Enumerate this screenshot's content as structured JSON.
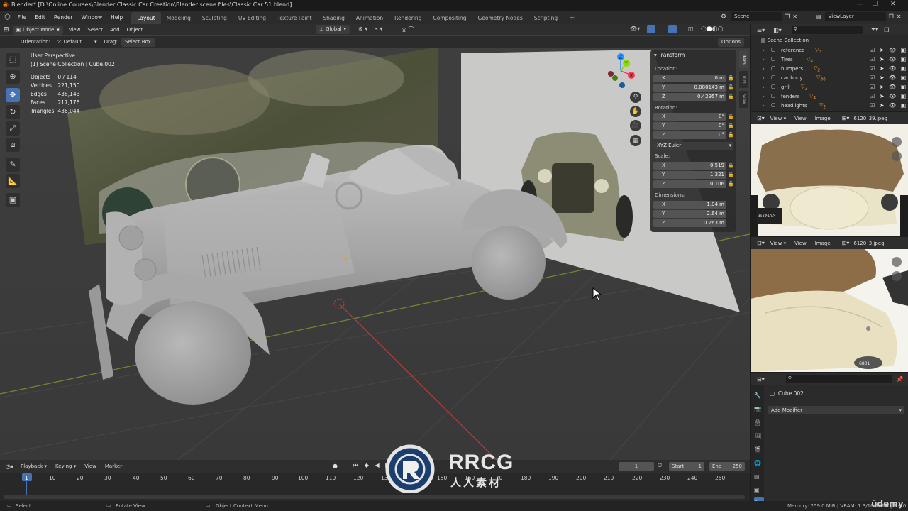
{
  "titlebar": {
    "title": "Blender* [D:\\Online Courses\\Blender Classic Car Creation\\Blender scene files\\Classic Car 51.blend]"
  },
  "menus": [
    "File",
    "Edit",
    "Render",
    "Window",
    "Help"
  ],
  "workspaces": [
    "Layout",
    "Modeling",
    "Sculpting",
    "UV Editing",
    "Texture Paint",
    "Shading",
    "Animation",
    "Rendering",
    "Compositing",
    "Geometry Nodes",
    "Scripting"
  ],
  "active_workspace": "Layout",
  "scene": {
    "scene_name": "Scene",
    "view_layer": "ViewLayer"
  },
  "viewport_header": {
    "mode": "Object Mode",
    "view": "View",
    "select": "Select",
    "add": "Add",
    "object": "Object",
    "transform_space": "Global"
  },
  "tool_header": {
    "orientation_label": "Orientation:",
    "orientation_value": "Default",
    "drag_label": "Drag:",
    "drag_value": "Select Box",
    "options": "Options"
  },
  "viewport_info": {
    "perspective": "User Perspective",
    "collection": "(1) Scene Collection | Cube.002"
  },
  "stats": [
    {
      "label": "Objects",
      "value": "0 / 114"
    },
    {
      "label": "Vertices",
      "value": "221,150"
    },
    {
      "label": "Edges",
      "value": "438,143"
    },
    {
      "label": "Faces",
      "value": "217,176"
    },
    {
      "label": "Triangles",
      "value": "436,044"
    }
  ],
  "npanel": {
    "title": "Transform",
    "location_label": "Location:",
    "location": [
      {
        "axis": "X",
        "value": "0 m"
      },
      {
        "axis": "Y",
        "value": "0.080143 m"
      },
      {
        "axis": "Z",
        "value": "0.42957 m"
      }
    ],
    "rotation_label": "Rotation:",
    "rotation": [
      {
        "axis": "X",
        "value": "0°"
      },
      {
        "axis": "Y",
        "value": "0°"
      },
      {
        "axis": "Z",
        "value": "0°"
      }
    ],
    "rotation_mode": "XYZ Euler",
    "scale_label": "Scale:",
    "scale": [
      {
        "axis": "X",
        "value": "0.519"
      },
      {
        "axis": "Y",
        "value": "1.321"
      },
      {
        "axis": "Z",
        "value": "0.106"
      }
    ],
    "dimensions_label": "Dimensions:",
    "dimensions": [
      {
        "axis": "X",
        "value": "1.04 m"
      },
      {
        "axis": "Y",
        "value": "2.64 m"
      },
      {
        "axis": "Z",
        "value": "0.263 m"
      }
    ],
    "tabs": [
      "Item",
      "Tool",
      "View"
    ]
  },
  "outliner": {
    "root": "Scene Collection",
    "items": [
      {
        "name": "reference",
        "badge": "3"
      },
      {
        "name": "Tires",
        "badge": "4"
      },
      {
        "name": "bumpers",
        "badge": "2"
      },
      {
        "name": "car body",
        "badge": "36"
      },
      {
        "name": "grill",
        "badge": "2"
      },
      {
        "name": "fenders",
        "badge": "4"
      },
      {
        "name": "headlights",
        "badge": "2"
      }
    ]
  },
  "image_editor_1": {
    "view": "View",
    "view2": "View",
    "image": "Image",
    "file": "6120_39.jpeg",
    "sign_text": "HYMAN"
  },
  "image_editor_2": {
    "view": "View",
    "view2": "View",
    "image": "Image",
    "file": "6120_3.jpeg",
    "badge_text": "6831"
  },
  "properties": {
    "object_name": "Cube.002",
    "add_modifier": "Add Modifier"
  },
  "timeline": {
    "menus": [
      "Playback",
      "Keying",
      "View",
      "Marker"
    ],
    "current_frame": "1",
    "start_label": "Start",
    "start": "1",
    "end_label": "End",
    "end": "250",
    "ticks": [
      "1",
      "10",
      "20",
      "30",
      "40",
      "50",
      "60",
      "70",
      "80",
      "90",
      "100",
      "110",
      "120",
      "130",
      "140",
      "150",
      "160",
      "170",
      "180",
      "190",
      "200",
      "210",
      "220",
      "230",
      "240",
      "250"
    ]
  },
  "statusbar": {
    "select": "Select",
    "rotate": "Rotate View",
    "context": "Object Context Menu",
    "memory": "Memory: 259.0 MiB | VRAM: 1.3/10.0 GiB | 3.0.0",
    "brand": "ūdemy"
  },
  "watermark": {
    "logo_text": "RRCG",
    "sub_text": "人人素材"
  },
  "colors": {
    "accent": "#4772b3",
    "axis_x": "#ff3352",
    "axis_y": "#8bdc00",
    "axis_z": "#2890ff",
    "viewport_bg": "#3a3a3a"
  }
}
